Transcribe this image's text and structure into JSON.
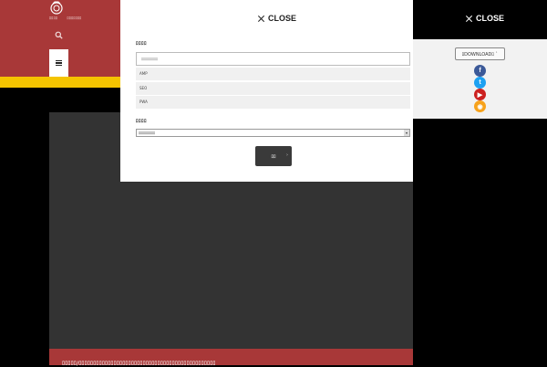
{
  "header": {
    "nav_links": [
      "ﾛﾛﾛﾛ",
      "ﾛﾛﾛﾛﾛﾛﾛ"
    ],
    "colors": {
      "brand_red": "#a83838",
      "accent_yellow": "#f5c400"
    }
  },
  "search_overlay": {
    "close_label": "CLOSE",
    "tags_label": "ﾛﾛﾛﾛ",
    "search_placeholder": "ﾛﾛﾛﾛﾛﾛﾛﾛﾛ",
    "tags": [
      "AMP",
      "SEO",
      "PWA"
    ],
    "category_label": "ﾛﾛﾛﾛ",
    "category_selected": "ﾛﾛﾛﾛﾛﾛﾛﾛﾛ",
    "submit_label": "ﾛﾛ"
  },
  "share_panel": {
    "close_label": "CLOSE",
    "download_label": "ﾛDOWNLOADﾛ",
    "download_suffix": "ﾞ",
    "social": [
      {
        "name": "facebook-icon",
        "glyph": "f",
        "color": "#3b5998"
      },
      {
        "name": "twitter-icon",
        "glyph": "t",
        "color": "#1da1f2"
      },
      {
        "name": "youtube-icon",
        "glyph": "▶",
        "color": "#cc2020"
      },
      {
        "name": "rss-icon",
        "glyph": "◉",
        "color": "#f7a21b"
      }
    ]
  },
  "footer": {
    "text": "ﾛﾛﾛﾛﾛ/ﾛﾛﾛﾛﾛﾛﾛﾛﾛﾛﾛﾛﾛﾛﾛﾛﾛﾛﾛﾛﾛﾛﾛﾛﾛﾛﾛﾛﾛﾛﾛﾛﾛﾛﾛﾛﾛﾛﾛﾛﾛﾛﾛﾛﾛﾛﾛ"
  }
}
